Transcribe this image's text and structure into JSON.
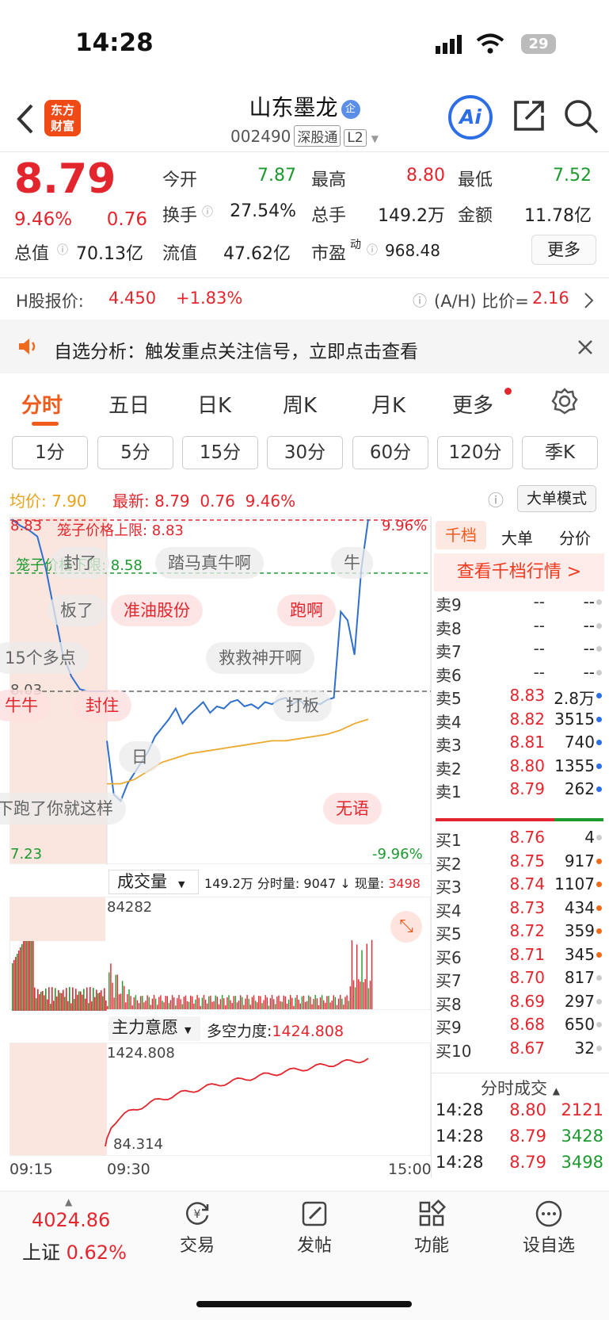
{
  "status": {
    "time": "14:28",
    "battery": "29"
  },
  "nav": {
    "title": "山东墨龙",
    "badge": "企",
    "code": "002490",
    "tag1": "深股通",
    "tag2": "L2",
    "logo": "东方\n财富",
    "ai": "Ai"
  },
  "quote": {
    "price": "8.79",
    "pct": "9.46%",
    "chg": "0.76",
    "cells": [
      {
        "l": "今开",
        "v": "7.87",
        "c": "green"
      },
      {
        "l": "最高",
        "v": "8.80",
        "c": "red"
      },
      {
        "l": "最低",
        "v": "7.52",
        "c": "green"
      },
      {
        "l": "换手",
        "v": "27.54%",
        "c": "dark"
      },
      {
        "l": "总手",
        "v": "149.2万",
        "c": "dark"
      },
      {
        "l": "金额",
        "v": "11.78亿",
        "c": "dark"
      }
    ],
    "total_label": "总值",
    "total": "70.13亿",
    "float_label": "流值",
    "float": "47.62亿",
    "pe_label": "市盈",
    "pe_sup": "动",
    "pe": "968.48",
    "more": "更多"
  },
  "hshare": {
    "label": "H股报价:",
    "price": "4.450",
    "pct": "+1.83%",
    "ratio_label": "(A/H) 比价=",
    "ratio": "2.16"
  },
  "notice": {
    "text": "自选分析：触发重点关注信号，立即点击查看"
  },
  "tabs": [
    "分时",
    "五日",
    "日K",
    "周K",
    "月K",
    "更多"
  ],
  "periods": [
    "1分",
    "5分",
    "15分",
    "30分",
    "60分",
    "120分",
    "季K"
  ],
  "chart_info": {
    "avg_label": "均价:",
    "avg": "7.90",
    "last_label": "最新:",
    "last": "8.79",
    "chg": "0.76",
    "pct": "9.46%",
    "mode": "大单模式"
  },
  "chart_data": {
    "type": "line",
    "x_range": [
      "09:15",
      "15:00"
    ],
    "price_axis": {
      "max": "8.83",
      "max_pct": "9.96%",
      "mid": "8.03",
      "min": "7.23",
      "min_pct": "-9.96%"
    },
    "upper_limit": "笼子价格上限: 8.83",
    "lower_limit": "笼子价格下限: 8.58",
    "series": [
      {
        "values": [
          8.83,
          8.8,
          8.78,
          8.75,
          8.6,
          8.4,
          8.2,
          8.1,
          8.04,
          8.03,
          8.03,
          8.03,
          7.8,
          7.55,
          7.52,
          7.6,
          7.65,
          7.7,
          7.75,
          7.82,
          7.86,
          7.9,
          7.95,
          7.88,
          7.92,
          7.95,
          7.98,
          7.93,
          7.96,
          7.95,
          7.98,
          7.99,
          7.96,
          7.97,
          7.95,
          7.98,
          7.97,
          7.99,
          8.0,
          7.97,
          7.99,
          7.96,
          7.98,
          7.97,
          7.99,
          8.0,
          8.4,
          8.36,
          8.2,
          8.6,
          8.83
        ]
      },
      {
        "values": [
          7.6,
          7.6,
          7.62,
          7.66,
          7.7,
          7.72,
          7.74,
          7.75,
          7.76,
          7.77,
          7.78,
          7.79,
          7.8,
          7.8,
          7.81,
          7.82,
          7.83,
          7.85,
          7.88,
          7.9
        ]
      }
    ]
  },
  "bubbles": [
    {
      "t": "踏马真牛啊",
      "r": false
    },
    {
      "t": "牛",
      "r": false
    },
    {
      "t": "板了",
      "r": false
    },
    {
      "t": "准油股份",
      "r": true
    },
    {
      "t": "跑啊",
      "r": true
    },
    {
      "t": "15个多点",
      "r": false
    },
    {
      "t": "救救神开啊",
      "r": false
    },
    {
      "t": "封住",
      "r": true
    },
    {
      "t": "打板",
      "r": false
    },
    {
      "t": "日",
      "r": false
    },
    {
      "t": "下跑了你就这样",
      "r": false
    },
    {
      "t": "无语",
      "r": true
    },
    {
      "t": "牛牛",
      "r": true
    },
    {
      "t": "封了",
      "r": false
    }
  ],
  "volume": {
    "label": "成交量",
    "total": "149.2万",
    "tick_label": "分时量:",
    "tick": "9047",
    "now_label": "现量:",
    "now": "3498",
    "max": "84282"
  },
  "main": {
    "label": "主力意愿",
    "force_label": "多空力度:",
    "force": "1424.808",
    "max": "1424.808",
    "min": "84.314"
  },
  "time_axis": {
    "start": "09:15",
    "open": "09:30",
    "end": "15:00"
  },
  "book_tabs": [
    "千档",
    "大单",
    "分价"
  ],
  "book_link": "查看千档行情 >",
  "asks": [
    [
      "卖9",
      "--",
      "--"
    ],
    [
      "卖8",
      "--",
      "--"
    ],
    [
      "卖7",
      "--",
      "--"
    ],
    [
      "卖6",
      "--",
      "--"
    ],
    [
      "卖5",
      "8.83",
      "2.8万"
    ],
    [
      "卖4",
      "8.82",
      "3515"
    ],
    [
      "卖3",
      "8.81",
      "740"
    ],
    [
      "卖2",
      "8.80",
      "1355"
    ],
    [
      "卖1",
      "8.79",
      "262"
    ]
  ],
  "bids": [
    [
      "买1",
      "8.76",
      "4"
    ],
    [
      "买2",
      "8.75",
      "917"
    ],
    [
      "买3",
      "8.74",
      "1107"
    ],
    [
      "买4",
      "8.73",
      "434"
    ],
    [
      "买5",
      "8.72",
      "359"
    ],
    [
      "买6",
      "8.71",
      "345"
    ],
    [
      "买7",
      "8.70",
      "817"
    ],
    [
      "买8",
      "8.69",
      "297"
    ],
    [
      "买9",
      "8.68",
      "650"
    ],
    [
      "买10",
      "8.67",
      "32"
    ]
  ],
  "ticks_title": "分时成交",
  "ticks": [
    [
      "14:28",
      "8.80",
      "2121"
    ],
    [
      "14:28",
      "8.79",
      "3428"
    ],
    [
      "14:28",
      "8.79",
      "3498"
    ]
  ],
  "bottom": {
    "index_value": "4024.86",
    "index_name": "上证",
    "index_pct": "0.62%",
    "items": [
      "交易",
      "发帖",
      "功能",
      "设自选"
    ]
  }
}
